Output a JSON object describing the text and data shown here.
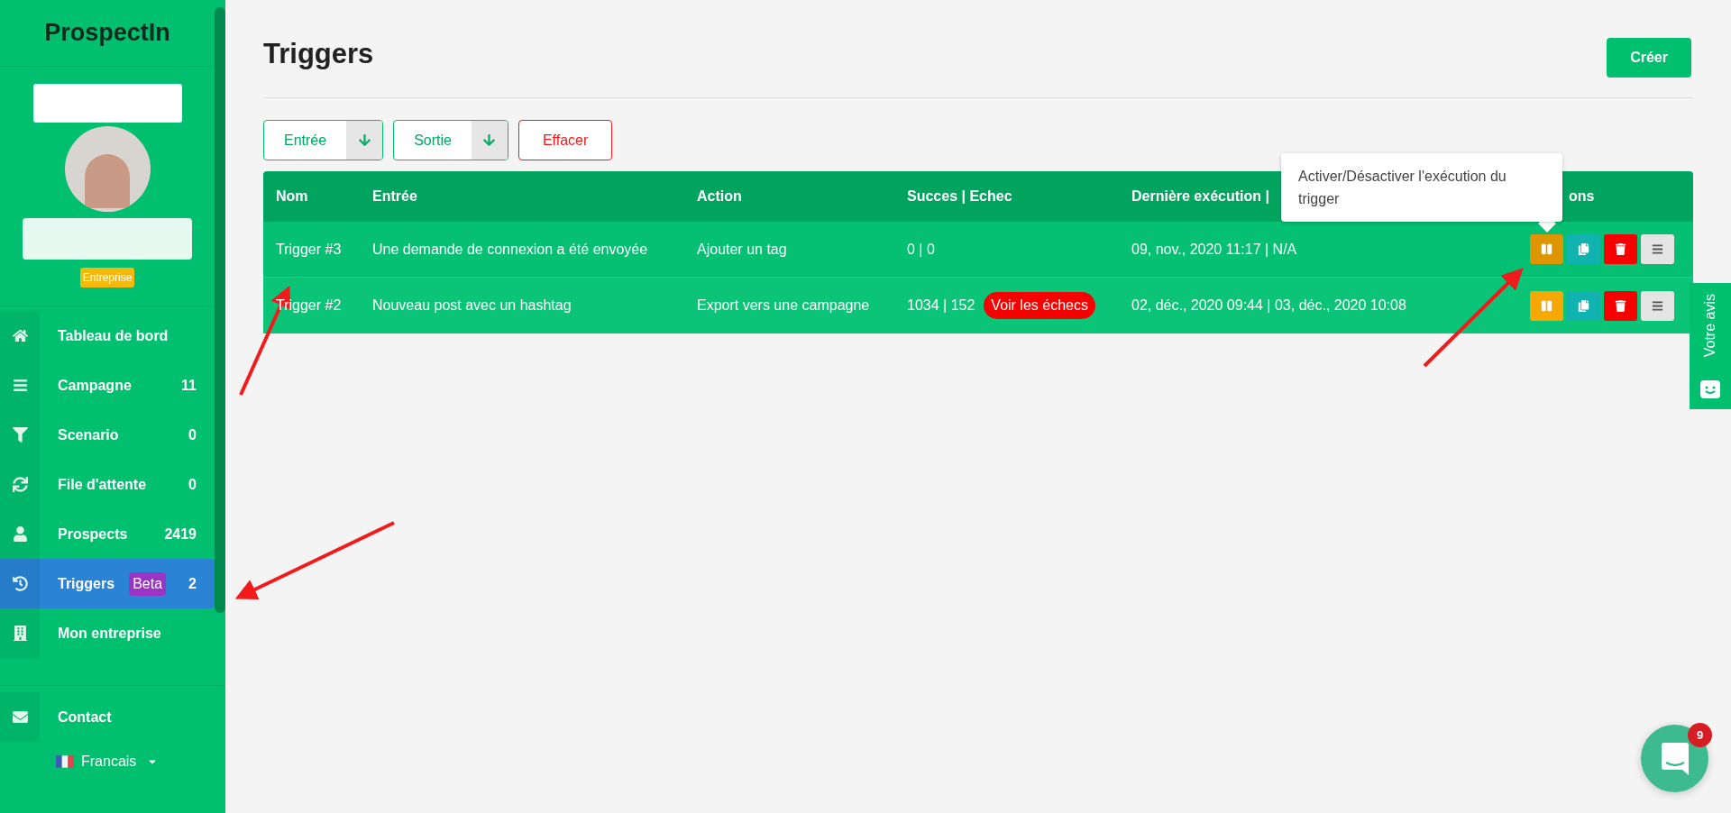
{
  "sidebar": {
    "brand": "ProspectIn",
    "plan_badge": "Entreprise",
    "items": [
      {
        "label": "Tableau de bord",
        "selected": false
      },
      {
        "label": "Campagne",
        "count": "11",
        "selected": false
      },
      {
        "label": "Scenario",
        "count": "0",
        "selected": false
      },
      {
        "label": "File d'attente",
        "count": "0",
        "selected": false
      },
      {
        "label": "Prospects",
        "count": "2419",
        "selected": false
      },
      {
        "label": "Triggers",
        "badge": "Beta",
        "count": "2",
        "selected": true
      },
      {
        "label": "Mon entreprise",
        "selected": false
      }
    ],
    "contact": "Contact",
    "language": "Francais"
  },
  "page": {
    "title": "Triggers",
    "create_button": "Créer"
  },
  "filters": [
    {
      "label": "Entrée",
      "kind": "dropdown"
    },
    {
      "label": "Sortie",
      "kind": "dropdown"
    },
    {
      "label": "Effacer",
      "kind": "clear"
    }
  ],
  "table": {
    "columns": [
      "Nom",
      "Entrée",
      "Action",
      "Succes | Echec",
      "Dernière exécution |",
      "ons"
    ],
    "rows": [
      {
        "name": "Trigger #3",
        "input": "Une demande de connexion a été envoyée",
        "action": "Ajouter un tag",
        "result": "0 | 0",
        "last_run": "09, nov., 2020 11:17 | N/A",
        "toggle_hovered": true
      },
      {
        "name": "Trigger #2",
        "input": "Nouveau post avec un hashtag",
        "action": "Export vers une campagne",
        "result": "1034 | 152",
        "failures_link": "Voir les échecs",
        "last_run": "02, déc., 2020 09:44 | 03, déc., 2020 10:08",
        "toggle_hovered": false
      }
    ]
  },
  "tooltip": "Activer/Désactiver l'exécution du trigger",
  "feedback_tab": "Votre avis",
  "chat": {
    "unread": "9"
  }
}
